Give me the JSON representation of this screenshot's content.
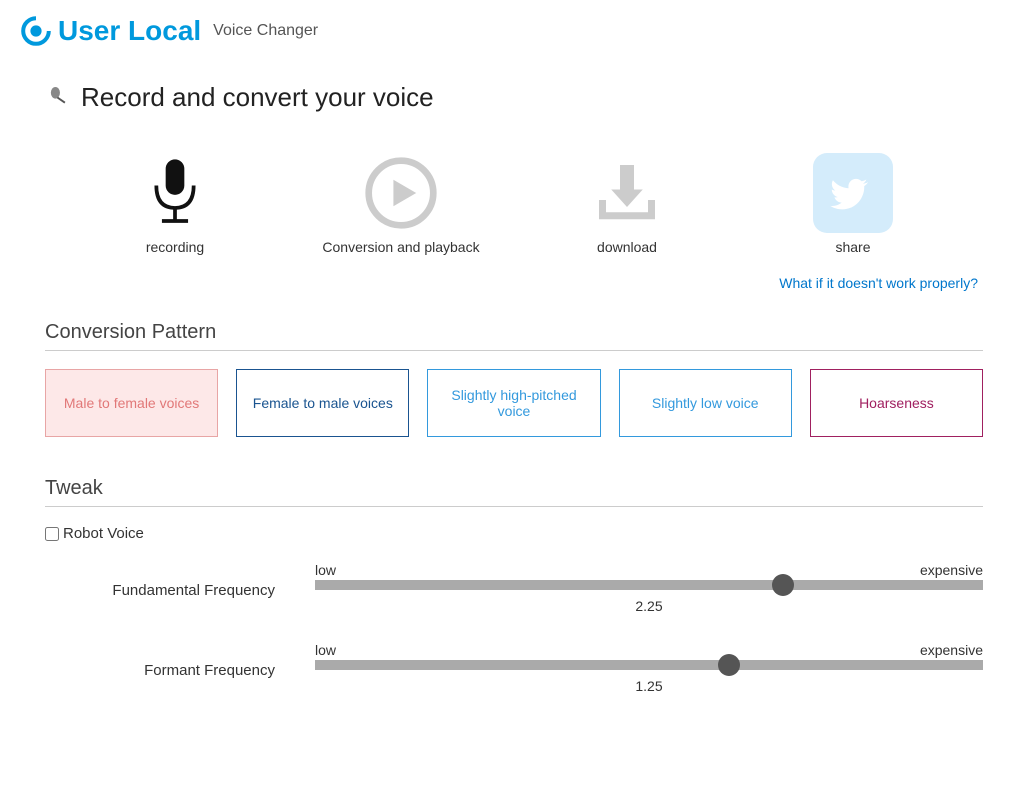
{
  "header": {
    "brand": "User Local",
    "subtitle": "Voice Changer"
  },
  "page_title": "Record and convert your voice",
  "actions": {
    "recording": "recording",
    "playback": "Conversion and playback",
    "download": "download",
    "share": "share"
  },
  "help_link": "What if it doesn't work properly?",
  "conversion": {
    "title": "Conversion Pattern",
    "patterns": {
      "m2f": "Male to female voices",
      "f2m": "Female to male voices",
      "high": "Slightly high-pitched voice",
      "low": "Slightly low voice",
      "hoarse": "Hoarseness"
    }
  },
  "tweak": {
    "title": "Tweak",
    "robot_voice_label": "Robot Voice",
    "robot_voice_checked": false,
    "sliders": {
      "fundamental": {
        "label": "Fundamental Frequency",
        "low_label": "low",
        "high_label": "expensive",
        "value": "2.25",
        "thumb_percent": 70
      },
      "formant": {
        "label": "Formant Frequency",
        "low_label": "low",
        "high_label": "expensive",
        "value": "1.25",
        "thumb_percent": 62
      }
    }
  },
  "colors": {
    "brand_blue": "#0099dd",
    "icon_gray": "#cccccc",
    "icon_dark": "#111111",
    "twitter_bg": "#d4ecfb"
  }
}
